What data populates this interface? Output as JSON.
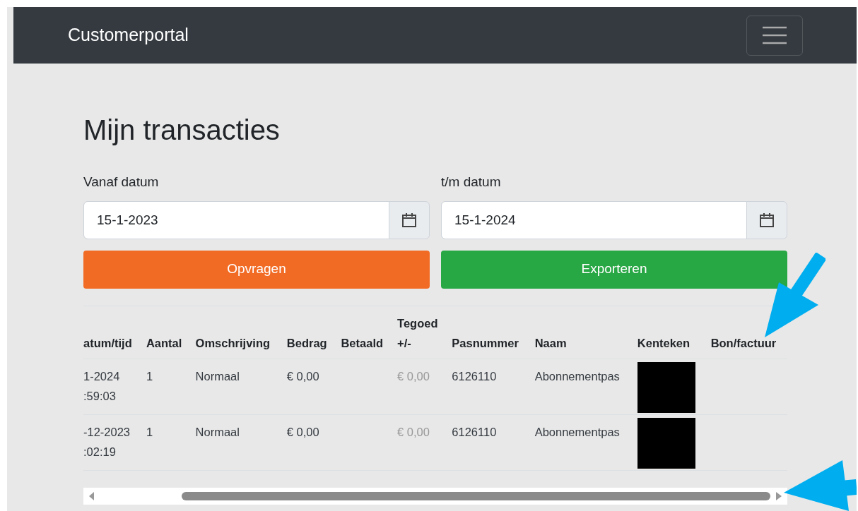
{
  "navbar": {
    "brand": "Customerportal"
  },
  "heading": "Mijn transacties",
  "filters": [
    {
      "label": "Vanaf datum",
      "value": "15-1-2023"
    },
    {
      "label": "t/m datum",
      "value": "15-1-2024"
    }
  ],
  "buttons": [
    {
      "label": "Opvragen",
      "kind": "query"
    },
    {
      "label": "Exporteren",
      "kind": "export"
    }
  ],
  "table": {
    "columns": [
      "atum/tijd",
      "Aantal",
      "Omschrijving",
      "Bedrag",
      "Betaald",
      "Tegoed +/-",
      "Pasnummer",
      "Naam",
      "Kenteken",
      "Bon/factuur"
    ],
    "rows": [
      {
        "datetime": [
          "1-2024",
          ":59:03"
        ],
        "aantal": "1",
        "omschrijving": "Normaal",
        "bedrag": "€ 0,00",
        "tegoed": "€ 0,00",
        "pasnummer": "6126110",
        "naam": "Abonnementpas"
      },
      {
        "datetime": [
          "-12-2023",
          ":02:19"
        ],
        "aantal": "1",
        "omschrijving": "Normaal",
        "bedrag": "€ 0,00",
        "tegoed": "€ 0,00",
        "pasnummer": "6126110",
        "naam": "Abonnementpas"
      }
    ]
  }
}
